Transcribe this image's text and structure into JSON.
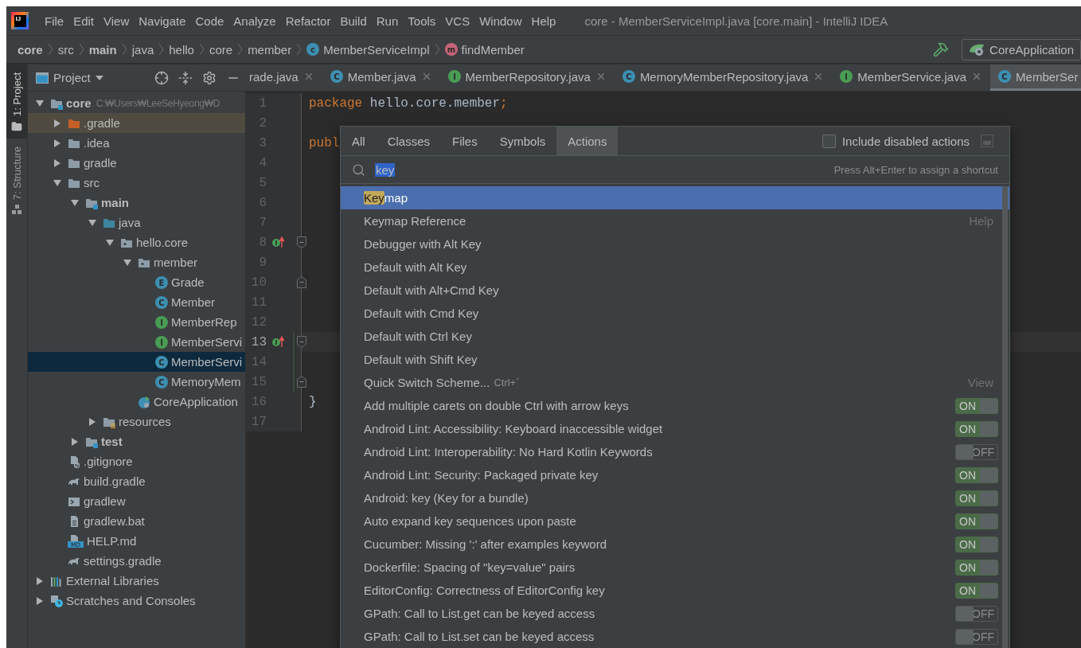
{
  "menu_bar": {
    "logo": "IJ",
    "items": [
      "File",
      "Edit",
      "View",
      "Navigate",
      "Code",
      "Analyze",
      "Refactor",
      "Build",
      "Run",
      "Tools",
      "VCS",
      "Window",
      "Help"
    ],
    "title": "core - MemberServiceImpl.java [core.main] - IntelliJ IDEA"
  },
  "breadcrumbs": [
    {
      "label": "core",
      "bold": true
    },
    {
      "label": "src",
      "bold": false
    },
    {
      "label": "main",
      "bold": true
    },
    {
      "label": "java",
      "bold": false
    },
    {
      "label": "hello",
      "bold": false
    },
    {
      "label": "core",
      "bold": false
    },
    {
      "label": "member",
      "bold": false
    },
    {
      "label": "MemberServiceImpl",
      "bold": false,
      "kind": "class",
      "letter": "c"
    },
    {
      "label": "findMember",
      "bold": false,
      "kind": "method",
      "letter": "m"
    }
  ],
  "run_config": {
    "label": "CoreApplication"
  },
  "tool_strip": [
    {
      "label": "1: Project",
      "kind": "project",
      "selected": true
    },
    {
      "label": "7: Structure",
      "kind": "structure",
      "selected": false
    }
  ],
  "project_panel": {
    "title": "Project",
    "tree": [
      {
        "name": "core",
        "kind": "module",
        "bold": true,
        "hint": "C:₩Users₩LeeSeHyeong₩D",
        "expanded": true,
        "selected": false,
        "highlighted": false,
        "children": [
          {
            "name": ".gradle",
            "kind": "folder-excluded",
            "bold": false,
            "expanded": false,
            "selected": false,
            "highlighted": true
          },
          {
            "name": ".idea",
            "kind": "folder",
            "bold": false,
            "expanded": false,
            "selected": false,
            "highlighted": false
          },
          {
            "name": "gradle",
            "kind": "folder",
            "bold": false,
            "expanded": false,
            "selected": false,
            "highlighted": false
          },
          {
            "name": "src",
            "kind": "folder",
            "bold": false,
            "expanded": true,
            "selected": false,
            "highlighted": false,
            "children": [
              {
                "name": "main",
                "kind": "module",
                "bold": true,
                "expanded": true,
                "selected": false,
                "highlighted": false,
                "children": [
                  {
                    "name": "java",
                    "kind": "source-folder",
                    "bold": false,
                    "expanded": true,
                    "selected": false,
                    "highlighted": false,
                    "children": [
                      {
                        "name": "hello.core",
                        "kind": "package",
                        "bold": false,
                        "expanded": true,
                        "selected": false,
                        "highlighted": false,
                        "children": [
                          {
                            "name": "member",
                            "kind": "package",
                            "bold": false,
                            "expanded": true,
                            "selected": false,
                            "highlighted": false,
                            "children": [
                              {
                                "name": "Grade",
                                "kind": "enum",
                                "letter": "E",
                                "bold": false,
                                "selected": false,
                                "highlighted": false
                              },
                              {
                                "name": "Member",
                                "kind": "class",
                                "letter": "C",
                                "bold": false,
                                "selected": false,
                                "highlighted": false
                              },
                              {
                                "name": "MemberRep",
                                "kind": "interface",
                                "letter": "I",
                                "bold": false,
                                "selected": false,
                                "highlighted": false
                              },
                              {
                                "name": "MemberServi",
                                "kind": "interface",
                                "letter": "I",
                                "bold": false,
                                "selected": false,
                                "highlighted": false
                              },
                              {
                                "name": "MemberServi",
                                "kind": "class",
                                "letter": "C",
                                "bold": false,
                                "selected": true,
                                "highlighted": false
                              },
                              {
                                "name": "MemoryMem",
                                "kind": "class",
                                "letter": "C",
                                "bold": false,
                                "selected": false,
                                "highlighted": false
                              }
                            ]
                          },
                          {
                            "name": "CoreApplication",
                            "kind": "spring-app",
                            "bold": false,
                            "selected": false,
                            "highlighted": false
                          }
                        ]
                      }
                    ]
                  },
                  {
                    "name": "resources",
                    "kind": "resources-folder",
                    "bold": false,
                    "expanded": false,
                    "selected": false,
                    "highlighted": false
                  }
                ]
              },
              {
                "name": "test",
                "kind": "module",
                "bold": true,
                "expanded": false,
                "selected": false,
                "highlighted": false
              }
            ]
          },
          {
            "name": ".gitignore",
            "kind": "ignore-file",
            "bold": false,
            "selected": false,
            "highlighted": false
          },
          {
            "name": "build.gradle",
            "kind": "gradle",
            "bold": false,
            "selected": false,
            "highlighted": false
          },
          {
            "name": "gradlew",
            "kind": "shell",
            "bold": false,
            "selected": false,
            "highlighted": false
          },
          {
            "name": "gradlew.bat",
            "kind": "text-file",
            "bold": false,
            "selected": false,
            "highlighted": false
          },
          {
            "name": "HELP.md",
            "kind": "markdown",
            "letter": "MD",
            "bold": false,
            "selected": false,
            "highlighted": false
          },
          {
            "name": "settings.gradle",
            "kind": "gradle",
            "bold": false,
            "selected": false,
            "highlighted": false
          }
        ]
      },
      {
        "name": "External Libraries",
        "kind": "libraries",
        "bold": false,
        "expanded": false,
        "selected": false,
        "highlighted": false
      },
      {
        "name": "Scratches and Consoles",
        "kind": "scratches",
        "bold": false,
        "expanded": false,
        "selected": false,
        "highlighted": false
      }
    ]
  },
  "editor": {
    "tabs": [
      {
        "label": "rade.java",
        "selected": false
      },
      {
        "label": "Member.java",
        "kind": "class",
        "letter": "C",
        "selected": false
      },
      {
        "label": "MemberRepository.java",
        "kind": "interface",
        "letter": "I",
        "selected": false
      },
      {
        "label": "MemoryMemberRepository.java",
        "kind": "class",
        "letter": "C",
        "selected": false
      },
      {
        "label": "MemberService.java",
        "kind": "interface",
        "letter": "I",
        "selected": false
      },
      {
        "label": "MemberSer",
        "kind": "class",
        "letter": "C",
        "selected": true
      }
    ],
    "lines": [
      {
        "number": "1",
        "code": [
          {
            "kind": "keyword",
            "text": "package"
          },
          {
            "kind": "plain",
            "text": " hello.core.member"
          },
          {
            "kind": "keyword",
            "text": ";"
          }
        ],
        "current": false,
        "changed": false
      },
      {
        "number": "2",
        "current": false,
        "changed": false
      },
      {
        "number": "3",
        "code": [
          {
            "kind": "keyword",
            "text": "publ"
          }
        ],
        "current": false,
        "changed": false
      },
      {
        "number": "4",
        "current": false,
        "changed": false
      },
      {
        "number": "5",
        "current": false,
        "changed": false
      },
      {
        "number": "6",
        "current": false,
        "changed": false
      },
      {
        "number": "7",
        "current": false,
        "changed": false
      },
      {
        "number": "8",
        "implements_marker": true,
        "fold_start": true,
        "current": false,
        "changed": false
      },
      {
        "number": "9",
        "current": false,
        "changed": false
      },
      {
        "number": "10",
        "fold_end": true,
        "current": false,
        "changed": false
      },
      {
        "number": "11",
        "current": false,
        "changed": false
      },
      {
        "number": "12",
        "current": false,
        "changed": false
      },
      {
        "number": "13",
        "implements_marker": true,
        "fold_start": true,
        "current": true,
        "changed": true
      },
      {
        "number": "14",
        "current": false,
        "changed": true
      },
      {
        "number": "15",
        "fold_end": true,
        "current": false,
        "changed": true
      },
      {
        "number": "16",
        "code": [
          {
            "kind": "plain",
            "text": "}"
          }
        ],
        "current": false,
        "changed": false
      },
      {
        "number": "17",
        "current": false,
        "changed": false
      }
    ]
  },
  "search_popup": {
    "tabs": [
      {
        "label": "All",
        "selected": false
      },
      {
        "label": "Classes",
        "selected": false
      },
      {
        "label": "Files",
        "selected": false
      },
      {
        "label": "Symbols",
        "selected": false
      },
      {
        "label": "Actions",
        "selected": true
      }
    ],
    "include_disabled": {
      "label": "Include disabled actions",
      "checked": false
    },
    "search": {
      "value": "key",
      "hint": "Press Alt+Enter to assign a shortcut"
    },
    "results": [
      {
        "kind": "action",
        "match": "Key",
        "label": "map",
        "selected": true
      },
      {
        "kind": "action",
        "label": "Keymap Reference",
        "hint": "Help",
        "selected": false
      },
      {
        "kind": "action",
        "label": "Debugger with Alt Key",
        "selected": false
      },
      {
        "kind": "action",
        "label": "Default with Alt Key",
        "selected": false
      },
      {
        "kind": "action",
        "label": "Default with Alt+Cmd Key",
        "selected": false
      },
      {
        "kind": "action",
        "label": "Default with Cmd Key",
        "selected": false
      },
      {
        "kind": "action",
        "label": "Default with Ctrl Key",
        "selected": false
      },
      {
        "kind": "action",
        "label": "Default with Shift Key",
        "selected": false
      },
      {
        "kind": "action",
        "label": "Quick Switch Scheme...",
        "shortcut": "Ctrl+`",
        "hint": "View",
        "selected": false
      },
      {
        "kind": "option",
        "label": "Add multiple carets on double Ctrl with arrow keys",
        "on": true,
        "toggle_text": "ON",
        "selected": false
      },
      {
        "kind": "option",
        "label": "Android Lint: Accessibility: Keyboard inaccessible widget",
        "on": true,
        "toggle_text": "ON",
        "selected": false
      },
      {
        "kind": "option",
        "label": "Android Lint: Interoperability: No Hard Kotlin Keywords",
        "on": false,
        "toggle_text": "OFF",
        "selected": false
      },
      {
        "kind": "option",
        "label": "Android Lint: Security: Packaged private key",
        "on": true,
        "toggle_text": "ON",
        "selected": false
      },
      {
        "kind": "option",
        "label": "Android: key (Key for a bundle)",
        "on": true,
        "toggle_text": "ON",
        "selected": false
      },
      {
        "kind": "option",
        "label": "Auto expand key sequences upon paste",
        "on": true,
        "toggle_text": "ON",
        "selected": false
      },
      {
        "kind": "option",
        "label": "Cucumber: Missing ':' after examples keyword",
        "on": true,
        "toggle_text": "ON",
        "selected": false
      },
      {
        "kind": "option",
        "label": "Dockerfile: Spacing of \"key=value\" pairs",
        "on": true,
        "toggle_text": "ON",
        "selected": false
      },
      {
        "kind": "option",
        "label": "EditorConfig: Correctness of EditorConfig key",
        "on": true,
        "toggle_text": "ON",
        "selected": false
      },
      {
        "kind": "option",
        "label": "GPath: Call to List.get can be keyed access",
        "on": false,
        "toggle_text": "OFF",
        "selected": false
      },
      {
        "kind": "option",
        "label": "GPath: Call to List.set can be keyed access",
        "on": false,
        "toggle_text": "OFF",
        "selected": false
      }
    ]
  }
}
